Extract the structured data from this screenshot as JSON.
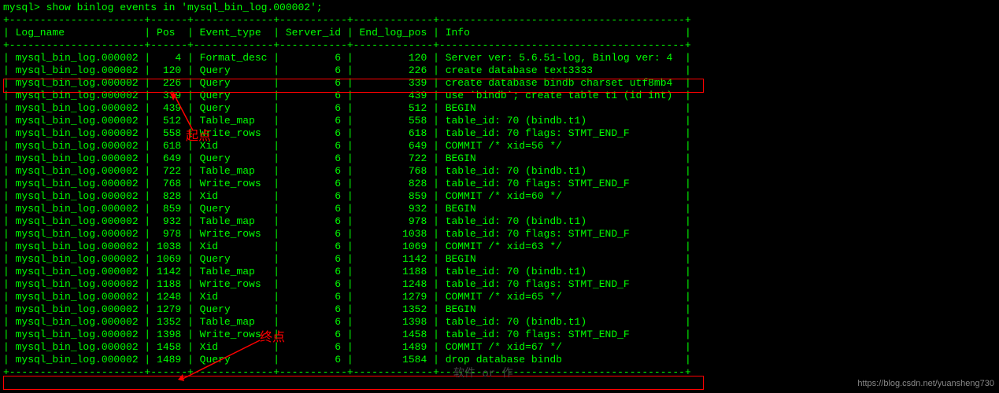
{
  "prompt": "mysql> show binlog events in 'mysql_bin_log.000002';",
  "columns": [
    "Log_name",
    "Pos",
    "Event_type",
    "Server_id",
    "End_log_pos",
    "Info"
  ],
  "rows": [
    {
      "log": "mysql_bin_log.000002",
      "pos": 4,
      "etype": "Format_desc",
      "sid": 6,
      "end": 120,
      "info": "Server ver: 5.6.51-log, Binlog ver: 4"
    },
    {
      "log": "mysql_bin_log.000002",
      "pos": 120,
      "etype": "Query",
      "sid": 6,
      "end": 226,
      "info": "create database text3333"
    },
    {
      "log": "mysql_bin_log.000002",
      "pos": 226,
      "etype": "Query",
      "sid": 6,
      "end": 339,
      "info": "create database bindb charset utf8mb4"
    },
    {
      "log": "mysql_bin_log.000002",
      "pos": 339,
      "etype": "Query",
      "sid": 6,
      "end": 439,
      "info": "use `bindb`; create table t1 (id int)"
    },
    {
      "log": "mysql_bin_log.000002",
      "pos": 439,
      "etype": "Query",
      "sid": 6,
      "end": 512,
      "info": "BEGIN"
    },
    {
      "log": "mysql_bin_log.000002",
      "pos": 512,
      "etype": "Table_map",
      "sid": 6,
      "end": 558,
      "info": "table_id: 70 (bindb.t1)"
    },
    {
      "log": "mysql_bin_log.000002",
      "pos": 558,
      "etype": "Write_rows",
      "sid": 6,
      "end": 618,
      "info": "table_id: 70 flags: STMT_END_F"
    },
    {
      "log": "mysql_bin_log.000002",
      "pos": 618,
      "etype": "Xid",
      "sid": 6,
      "end": 649,
      "info": "COMMIT /* xid=56 */"
    },
    {
      "log": "mysql_bin_log.000002",
      "pos": 649,
      "etype": "Query",
      "sid": 6,
      "end": 722,
      "info": "BEGIN"
    },
    {
      "log": "mysql_bin_log.000002",
      "pos": 722,
      "etype": "Table_map",
      "sid": 6,
      "end": 768,
      "info": "table_id: 70 (bindb.t1)"
    },
    {
      "log": "mysql_bin_log.000002",
      "pos": 768,
      "etype": "Write_rows",
      "sid": 6,
      "end": 828,
      "info": "table_id: 70 flags: STMT_END_F"
    },
    {
      "log": "mysql_bin_log.000002",
      "pos": 828,
      "etype": "Xid",
      "sid": 6,
      "end": 859,
      "info": "COMMIT /* xid=60 */"
    },
    {
      "log": "mysql_bin_log.000002",
      "pos": 859,
      "etype": "Query",
      "sid": 6,
      "end": 932,
      "info": "BEGIN"
    },
    {
      "log": "mysql_bin_log.000002",
      "pos": 932,
      "etype": "Table_map",
      "sid": 6,
      "end": 978,
      "info": "table_id: 70 (bindb.t1)"
    },
    {
      "log": "mysql_bin_log.000002",
      "pos": 978,
      "etype": "Write_rows",
      "sid": 6,
      "end": 1038,
      "info": "table_id: 70 flags: STMT_END_F"
    },
    {
      "log": "mysql_bin_log.000002",
      "pos": 1038,
      "etype": "Xid",
      "sid": 6,
      "end": 1069,
      "info": "COMMIT /* xid=63 */"
    },
    {
      "log": "mysql_bin_log.000002",
      "pos": 1069,
      "etype": "Query",
      "sid": 6,
      "end": 1142,
      "info": "BEGIN"
    },
    {
      "log": "mysql_bin_log.000002",
      "pos": 1142,
      "etype": "Table_map",
      "sid": 6,
      "end": 1188,
      "info": "table_id: 70 (bindb.t1)"
    },
    {
      "log": "mysql_bin_log.000002",
      "pos": 1188,
      "etype": "Write_rows",
      "sid": 6,
      "end": 1248,
      "info": "table_id: 70 flags: STMT_END_F"
    },
    {
      "log": "mysql_bin_log.000002",
      "pos": 1248,
      "etype": "Xid",
      "sid": 6,
      "end": 1279,
      "info": "COMMIT /* xid=65 */"
    },
    {
      "log": "mysql_bin_log.000002",
      "pos": 1279,
      "etype": "Query",
      "sid": 6,
      "end": 1352,
      "info": "BEGIN"
    },
    {
      "log": "mysql_bin_log.000002",
      "pos": 1352,
      "etype": "Table_map",
      "sid": 6,
      "end": 1398,
      "info": "table_id: 70 (bindb.t1)"
    },
    {
      "log": "mysql_bin_log.000002",
      "pos": 1398,
      "etype": "Write_rows",
      "sid": 6,
      "end": 1458,
      "info": "table_id: 70 flags: STMT_END_F"
    },
    {
      "log": "mysql_bin_log.000002",
      "pos": 1458,
      "etype": "Xid",
      "sid": 6,
      "end": 1489,
      "info": "COMMIT /* xid=67 */"
    },
    {
      "log": "mysql_bin_log.000002",
      "pos": 1489,
      "etype": "Query",
      "sid": 6,
      "end": 1584,
      "info": "drop database bindb"
    }
  ],
  "col_widths": {
    "log": 22,
    "pos": 6,
    "etype": 13,
    "sid": 11,
    "end": 13,
    "info": 40
  },
  "annotations": {
    "start": "起点",
    "end": "终点"
  },
  "footer": "https://blog.csdn.net/yuansheng730"
}
